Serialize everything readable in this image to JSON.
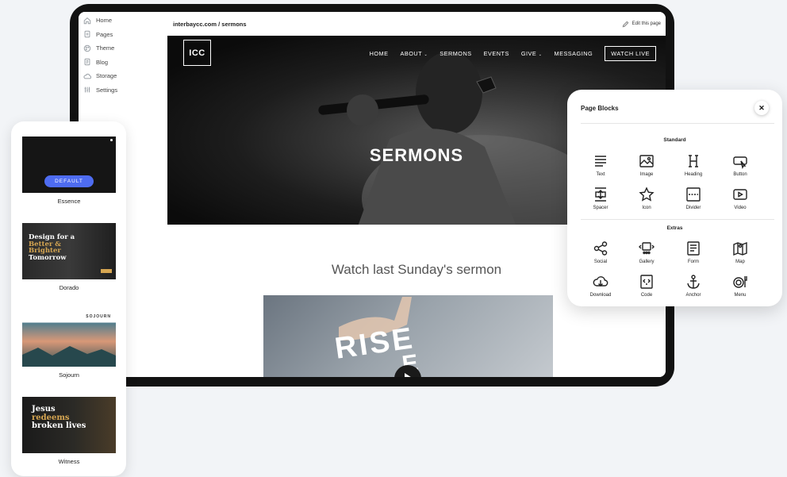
{
  "editor": {
    "url": "interbaycc.com / sermons",
    "edit_label": "Edit this page",
    "sidebar": [
      {
        "label": "Home",
        "icon": "home-icon"
      },
      {
        "label": "Pages",
        "icon": "pages-icon"
      },
      {
        "label": "Theme",
        "icon": "theme-icon"
      },
      {
        "label": "Blog",
        "icon": "blog-icon"
      },
      {
        "label": "Storage",
        "icon": "storage-icon"
      },
      {
        "label": "Settings",
        "icon": "settings-icon"
      }
    ]
  },
  "site": {
    "logo": "ICC",
    "nav": [
      "HOME",
      "ABOUT",
      "SERMONS",
      "EVENTS",
      "GIVE",
      "MESSAGING"
    ],
    "watch_live": "WATCH LIVE",
    "hero_title": "SERMONS",
    "section_title": "Watch last Sunday's sermon",
    "video_text_1": "RISE",
    "video_text_2": "E"
  },
  "themes": [
    {
      "name": "Essence",
      "button": "DEFAULT"
    },
    {
      "name": "Dorado",
      "headline": [
        "Design for a",
        "Better &",
        "Brighter",
        "Tomorrow"
      ]
    },
    {
      "name": "Sojourn",
      "brand": "SOJOURN"
    },
    {
      "name": "Witness",
      "headline": [
        "Jesus",
        "redeems",
        "broken lives"
      ]
    }
  ],
  "page_blocks": {
    "title": "Page Blocks",
    "standard_label": "Standard",
    "extras_label": "Extras",
    "standard": [
      {
        "label": "Text",
        "icon": "text-icon"
      },
      {
        "label": "Image",
        "icon": "image-icon"
      },
      {
        "label": "Heading",
        "icon": "heading-icon"
      },
      {
        "label": "Button",
        "icon": "button-icon"
      },
      {
        "label": "Spacer",
        "icon": "spacer-icon"
      },
      {
        "label": "Icon",
        "icon": "star-icon"
      },
      {
        "label": "Divider",
        "icon": "divider-icon"
      },
      {
        "label": "Video",
        "icon": "video-icon"
      }
    ],
    "extras": [
      {
        "label": "Social",
        "icon": "share-icon"
      },
      {
        "label": "Gallery",
        "icon": "gallery-icon"
      },
      {
        "label": "Form",
        "icon": "form-icon"
      },
      {
        "label": "Map",
        "icon": "map-icon"
      },
      {
        "label": "Download",
        "icon": "download-icon"
      },
      {
        "label": "Code",
        "icon": "code-icon"
      },
      {
        "label": "Anchor",
        "icon": "anchor-icon"
      },
      {
        "label": "Menu",
        "icon": "menu-icon"
      }
    ]
  },
  "colors": {
    "accent": "#4e6cf1",
    "gold": "#d6a652"
  }
}
